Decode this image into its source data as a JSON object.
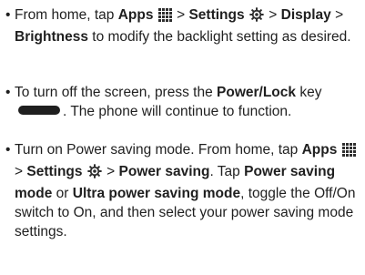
{
  "bullet_symbol": "•",
  "separator": ">",
  "icons": {
    "apps": "apps-grid-icon",
    "settings": "settings-gear-icon",
    "power_key": "power-key-icon"
  },
  "colors": {
    "text": "#1f1f1f",
    "apps_icon": "#2e2e2e",
    "settings_icon": "#2e2e2e"
  },
  "item1": {
    "t1": "From home, tap ",
    "apps": "Apps",
    "settings": "Settings",
    "display": "Display",
    "brightness": "Brightness",
    "t2": " to modify the backlight setting as desired."
  },
  "item2": {
    "t1": "To turn off the screen, press the ",
    "power_lock": "Power/Lock",
    "t2": " key",
    "t3": ". The phone will continue to function."
  },
  "item3": {
    "t1": "Turn on Power saving mode. From home, tap ",
    "apps": "Apps",
    "settings": "Settings",
    "power_saving": "Power saving",
    "t2": ". Tap ",
    "power_saving_mode": "Power saving mode",
    "t3": " or ",
    "ultra_power_saving_mode": "Ultra power saving mode",
    "t4": ", toggle the Off/On switch to On, and then select your power saving mode settings."
  }
}
